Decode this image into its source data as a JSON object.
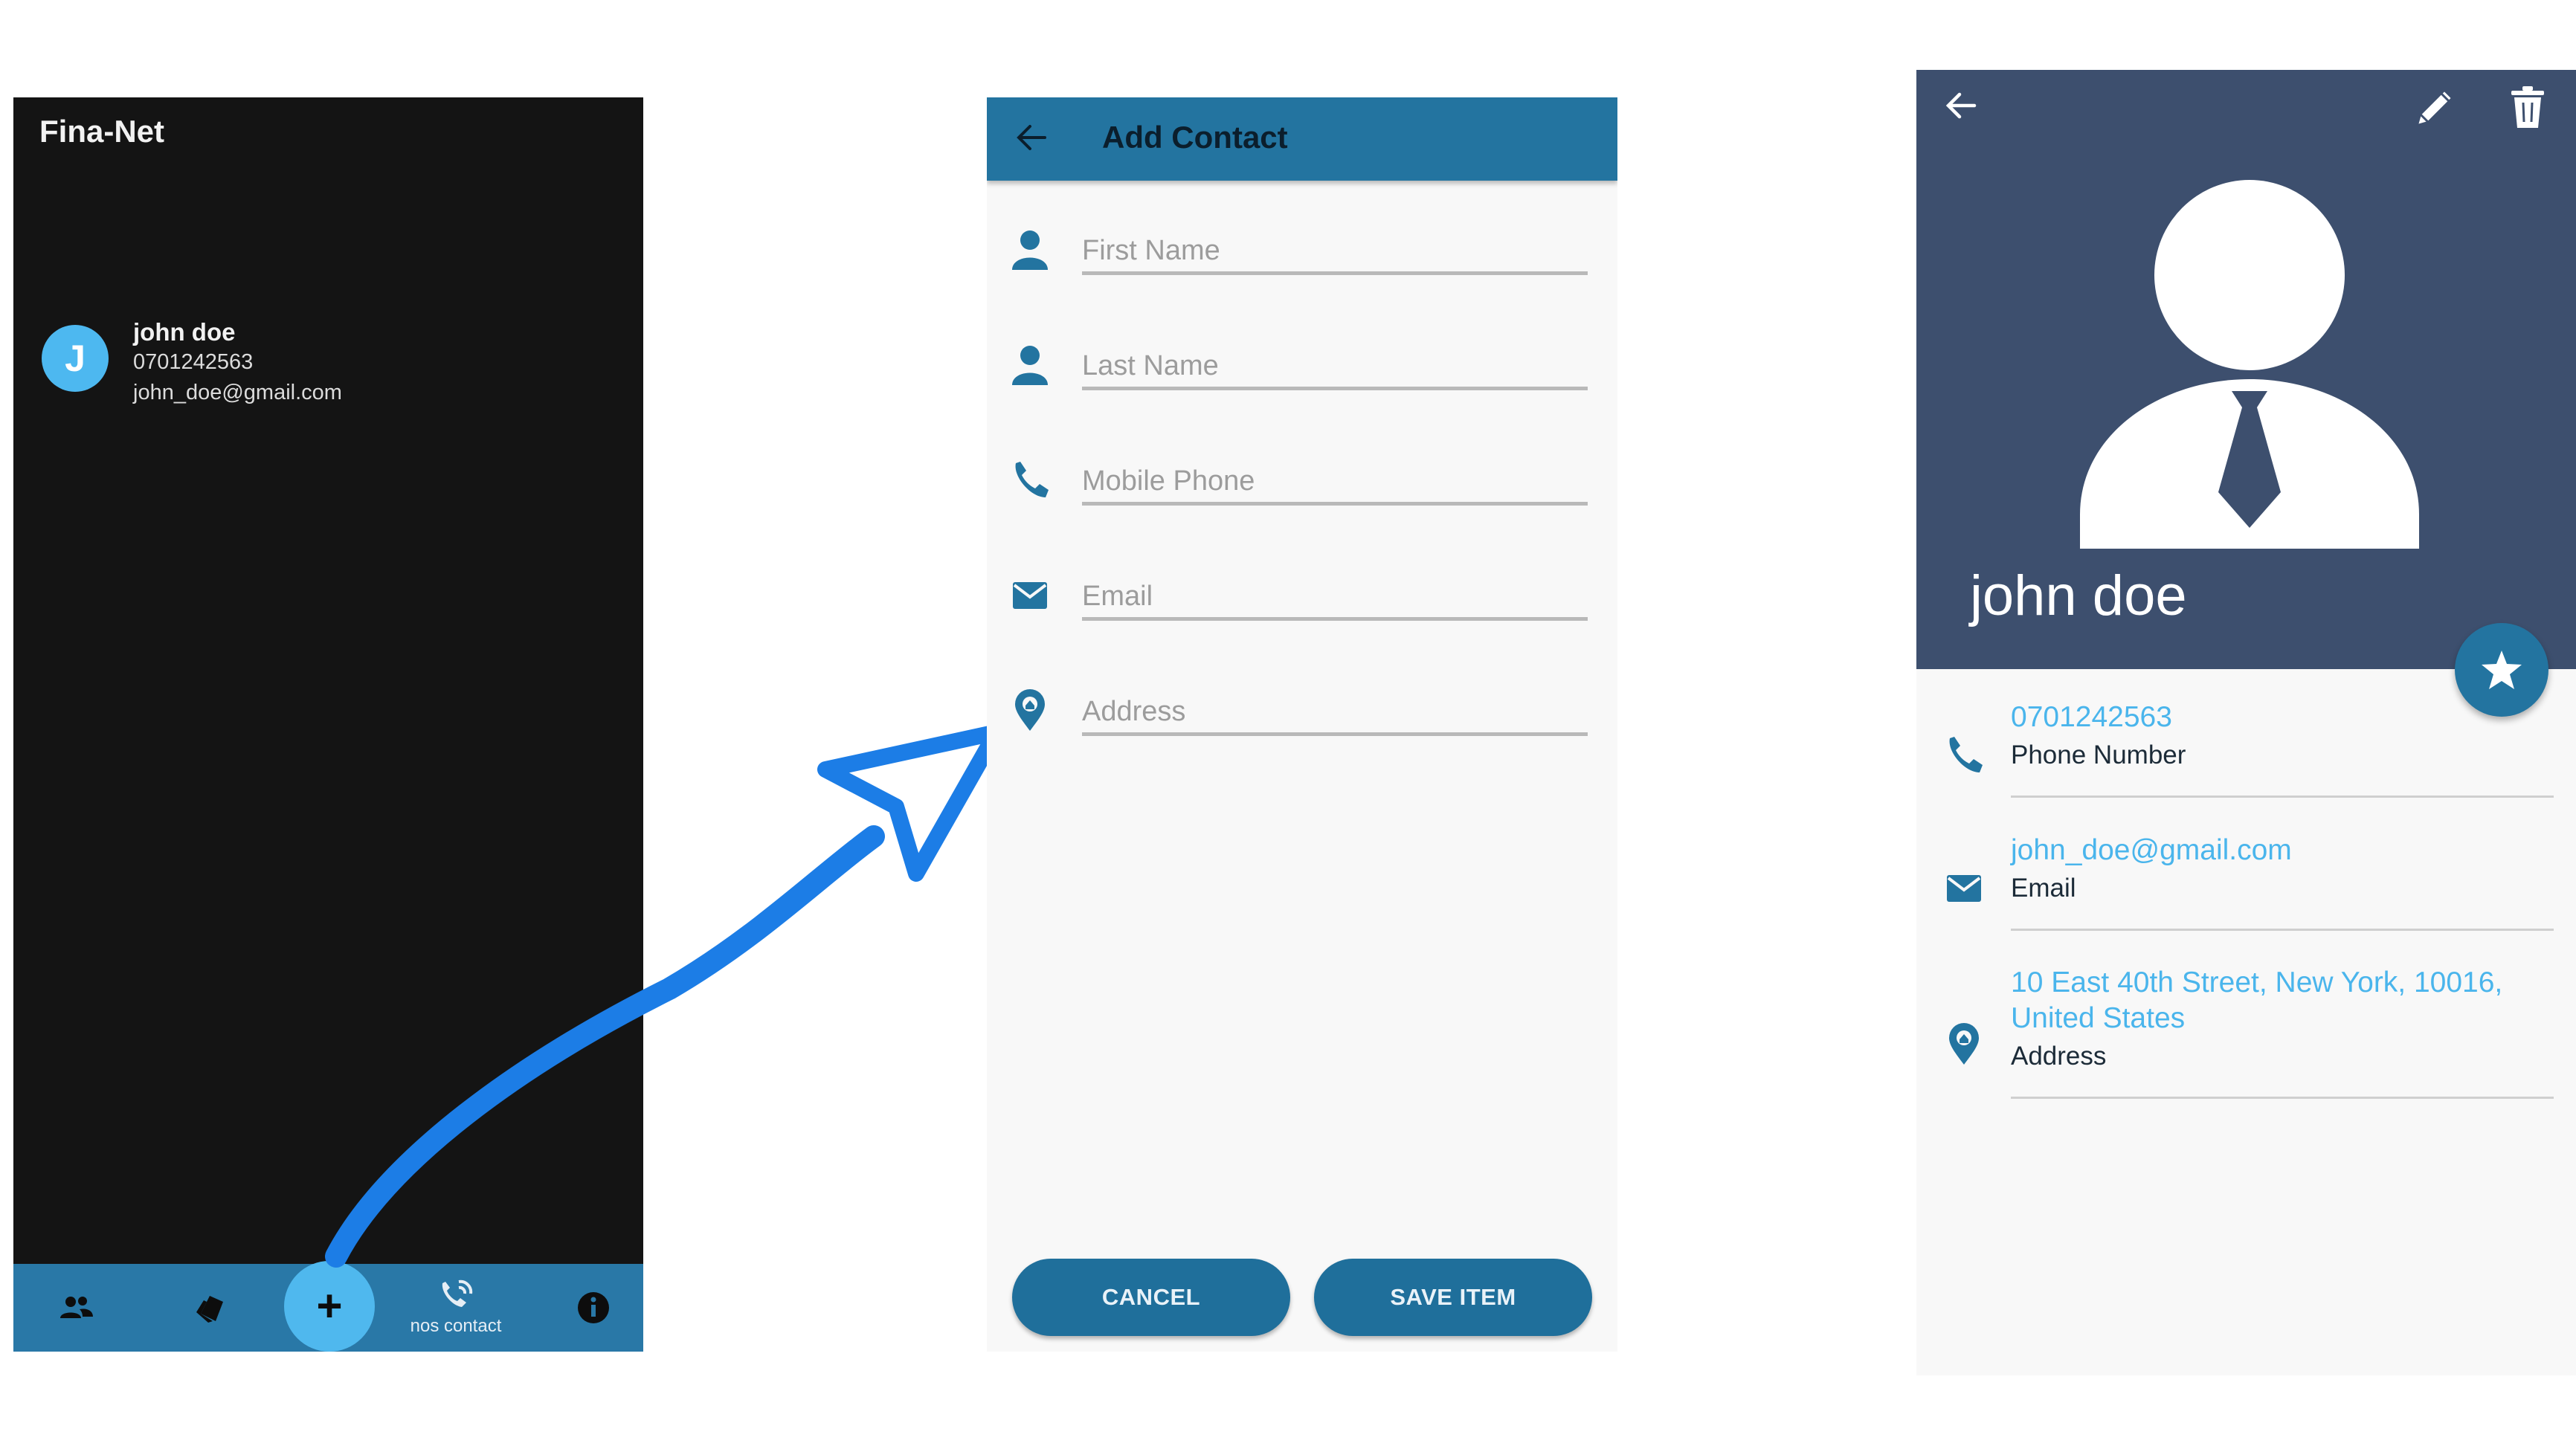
{
  "list_screen": {
    "app_title": "Fina-Net",
    "contact": {
      "avatar_letter": "J",
      "name": "john doe",
      "phone": "0701242563",
      "email": "john_doe@gmail.com"
    },
    "bottom_nav": {
      "add_label": "+",
      "nos_contact_label": "nos contact"
    }
  },
  "add_screen": {
    "title": "Add Contact",
    "fields": [
      {
        "placeholder": "First Name",
        "icon": "person-icon"
      },
      {
        "placeholder": "Last Name",
        "icon": "person-icon"
      },
      {
        "placeholder": "Mobile Phone",
        "icon": "phone-icon"
      },
      {
        "placeholder": "Email",
        "icon": "email-icon"
      },
      {
        "placeholder": "Address",
        "icon": "location-icon"
      }
    ],
    "cancel_label": "CANCEL",
    "save_label": "SAVE ITEM"
  },
  "detail_screen": {
    "name": "john doe",
    "rows": [
      {
        "value": "0701242563",
        "label": "Phone Number",
        "icon": "phone-icon"
      },
      {
        "value": "john_doe@gmail.com",
        "label": "Email",
        "icon": "email-icon"
      },
      {
        "value_line1": "10 East 40th Street, New York, 10016,",
        "value_line2": "United States",
        "label": "Address",
        "icon": "location-icon"
      }
    ]
  },
  "colors": {
    "primary": "#2374a0",
    "accent": "#4ab5ec",
    "header": "#3d4f6e",
    "dark_bg": "#141414",
    "arrow": "#1c7de6"
  }
}
